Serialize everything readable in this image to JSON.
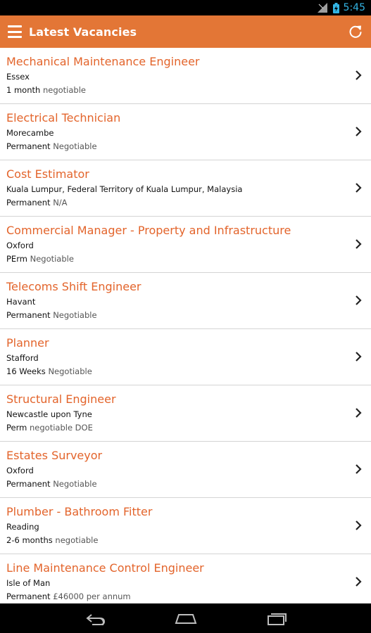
{
  "status_bar": {
    "time": "5:45",
    "icons": [
      "signal-icon",
      "battery-icon"
    ]
  },
  "action_bar": {
    "title": "Latest Vacancies",
    "icons": [
      "menu-icon",
      "refresh-icon"
    ]
  },
  "colors": {
    "accent": "#e37636",
    "title_text": "#e3642b",
    "status_blue": "#33b5e5"
  },
  "jobs": [
    {
      "title": "Mechanical Maintenance Engineer",
      "location": "Essex",
      "type": "1 month",
      "rate": "negotiable"
    },
    {
      "title": "Electrical Technician",
      "location": "Morecambe",
      "type": "Permanent",
      "rate": "Negotiable"
    },
    {
      "title": "Cost Estimator",
      "location": "Kuala Lumpur, Federal Territory of Kuala Lumpur, Malaysia",
      "type": "Permanent",
      "rate": "N/A"
    },
    {
      "title": "Commercial Manager - Property and Infrastructure",
      "location": "Oxford",
      "type": "PErm",
      "rate": "Negotiable"
    },
    {
      "title": "Telecoms Shift Engineer",
      "location": "Havant",
      "type": "Permanent",
      "rate": "Negotiable"
    },
    {
      "title": "Planner",
      "location": "Stafford",
      "type": "16 Weeks",
      "rate": "Negotiable"
    },
    {
      "title": "Structural Engineer",
      "location": "Newcastle upon Tyne",
      "type": "Perm",
      "rate": "negotiable DOE"
    },
    {
      "title": "Estates Surveyor",
      "location": "Oxford",
      "type": "Permanent",
      "rate": "Negotiable"
    },
    {
      "title": "Plumber - Bathroom Fitter",
      "location": "Reading",
      "type": "2-6 months",
      "rate": "negotiable"
    },
    {
      "title": "Line Maintenance Control Engineer",
      "location": "Isle of Man",
      "type": "Permanent",
      "rate": "£46000 per annum"
    }
  ],
  "nav_bar": {
    "icons": [
      "back-icon",
      "home-icon",
      "recent-apps-icon"
    ]
  }
}
